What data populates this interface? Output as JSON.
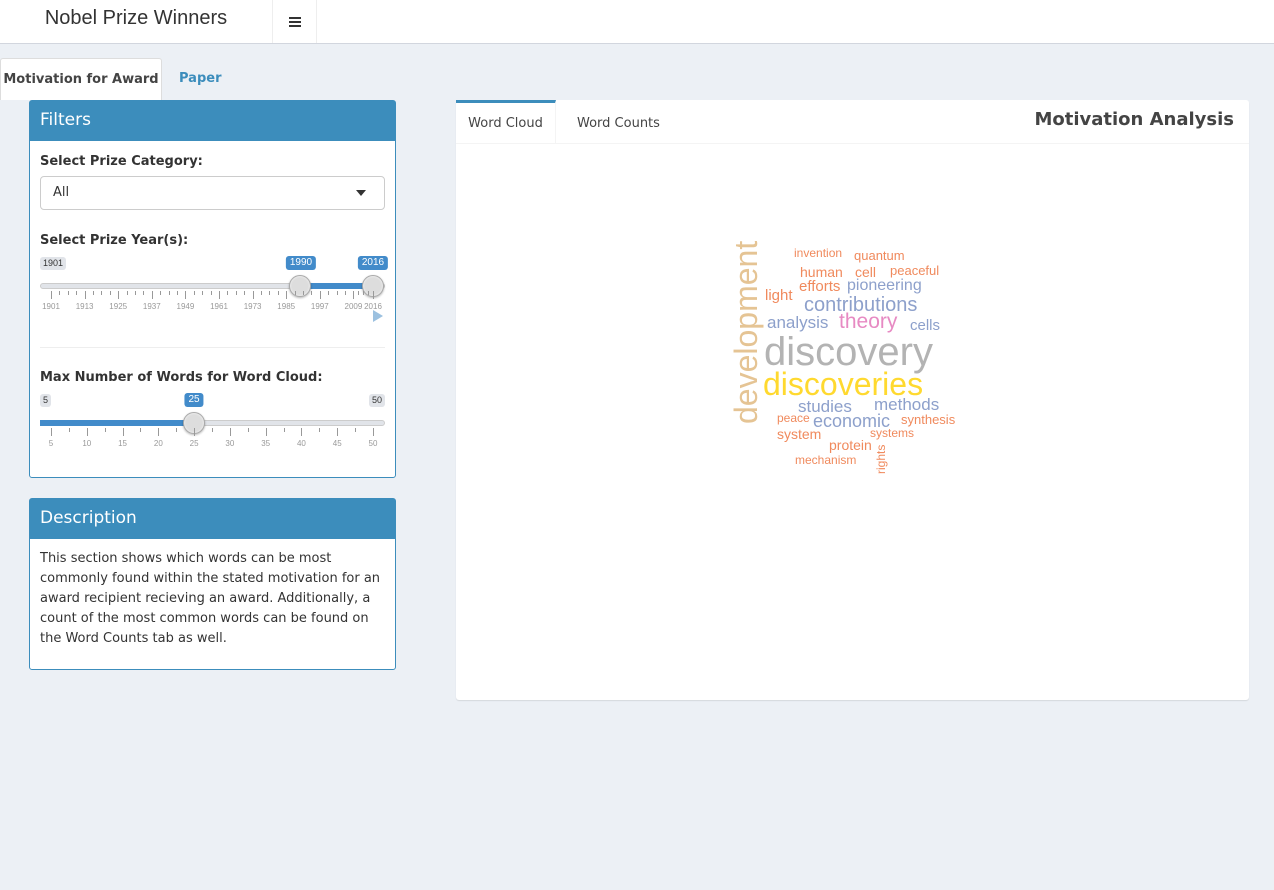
{
  "header": {
    "title": "Nobel Prize Winners",
    "toggle_icon": "hamburger-icon"
  },
  "top_tabs": [
    {
      "label": "Motivation for Award",
      "active": true
    },
    {
      "label": "Paper Titles",
      "active": false
    }
  ],
  "filters": {
    "title": "Filters",
    "category_label": "Select Prize Category:",
    "category_value": "All",
    "year_label": "Select Prize Year(s):",
    "year_slider": {
      "min": 1901,
      "max": 2016,
      "from": 1990,
      "to": 2016,
      "min_label": "1901",
      "max_label": "2016",
      "from_label": "1990",
      "to_label": "2016",
      "ticks": [
        "1901",
        "1913",
        "1925",
        "1937",
        "1949",
        "1961",
        "1973",
        "1985",
        "1997",
        "2009",
        "2016"
      ],
      "play_icon": "play-icon"
    },
    "words_label": "Max Number of Words for Word Cloud:",
    "words_slider": {
      "min": 5,
      "max": 50,
      "value": 25,
      "min_label": "5",
      "max_label": "50",
      "value_label": "25",
      "ticks": [
        "5",
        "10",
        "15",
        "20",
        "25",
        "30",
        "35",
        "40",
        "45",
        "50"
      ]
    }
  },
  "description": {
    "title": "Description",
    "text": "This section shows which words can be most commonly found within the stated motivation for an award recipient recieving an award. Additionally, a count of the most common words can be found on the Word Counts tab as well."
  },
  "analysis": {
    "title": "Motivation Analysis",
    "tabs": [
      {
        "label": "Word Cloud",
        "active": true
      },
      {
        "label": "Word Counts",
        "active": false
      }
    ]
  },
  "word_cloud": [
    {
      "text": "invention",
      "color": "#f08a5d"
    },
    {
      "text": "quantum",
      "color": "#f08a5d"
    },
    {
      "text": "human",
      "color": "#f08a5d"
    },
    {
      "text": "cell",
      "color": "#f08a5d"
    },
    {
      "text": "peaceful",
      "color": "#f08a5d"
    },
    {
      "text": "light",
      "color": "#f08a5d"
    },
    {
      "text": "efforts",
      "color": "#f08a5d"
    },
    {
      "text": "pioneering",
      "color": "#8da0cb"
    },
    {
      "text": "contributions",
      "color": "#8da0cb"
    },
    {
      "text": "analysis",
      "color": "#8da0cb"
    },
    {
      "text": "theory",
      "color": "#e78ac3"
    },
    {
      "text": "cells",
      "color": "#8da0cb"
    },
    {
      "text": "development",
      "color": "#e5c494"
    },
    {
      "text": "discovery",
      "color": "#b3b3b3"
    },
    {
      "text": "discoveries",
      "color": "#ffd92f"
    },
    {
      "text": "studies",
      "color": "#8da0cb"
    },
    {
      "text": "methods",
      "color": "#8da0cb"
    },
    {
      "text": "peace",
      "color": "#f08a5d"
    },
    {
      "text": "economic",
      "color": "#8da0cb"
    },
    {
      "text": "synthesis",
      "color": "#f08a5d"
    },
    {
      "text": "system",
      "color": "#f08a5d"
    },
    {
      "text": "systems",
      "color": "#f08a5d"
    },
    {
      "text": "protein",
      "color": "#f08a5d"
    },
    {
      "text": "rights",
      "color": "#f08a5d"
    },
    {
      "text": "mechanism",
      "color": "#f08a5d"
    }
  ]
}
